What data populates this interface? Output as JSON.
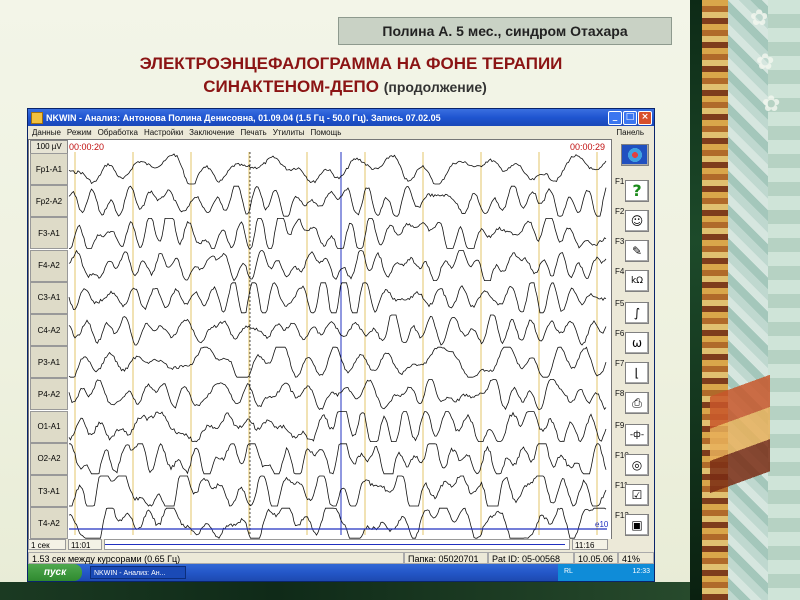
{
  "slide": {
    "patient_label": "Полина А. 5 мес., синдром Отахара",
    "title_line1": "ЭЛЕКТРОЭНЦЕФАЛОГРАММА НА ФОНЕ ТЕРАПИИ",
    "title_line2": "СИНАКТЕНОМ-ДЕПО",
    "title_line2_suffix": "(продолжение)"
  },
  "window": {
    "title": "NKWIN - Анализ: Антонова Полина Денисовна, 01.09.04 (1.5 Гц - 50.0 Гц). Запись 07.02.05",
    "buttons": [
      "_",
      "□",
      "×"
    ]
  },
  "menu": {
    "items": [
      "Данные",
      "Режим",
      "Обработка",
      "Настройки",
      "Заключение",
      "Печать",
      "Утилиты",
      "Помощь"
    ],
    "panel": "Панель"
  },
  "eeg": {
    "scale": "100 µV",
    "time_start": "00:00:20",
    "time_end": "00:00:29",
    "channels": [
      "Fp1-A1",
      "Fp2-A2",
      "F3-A1",
      "F4-A2",
      "C3-A1",
      "C4-A2",
      "P3-A1",
      "P4-A2",
      "O1-A1",
      "O2-A2",
      "T3-A1",
      "T4-A2"
    ],
    "marker_label": "e10"
  },
  "side_panel": {
    "buttons": [
      {
        "key": "",
        "icon": "brain-map-icon"
      },
      {
        "key": "F1",
        "icon": "help-icon",
        "glyph": "?"
      },
      {
        "key": "F2",
        "icon": "face-icon",
        "glyph": "☺"
      },
      {
        "key": "F3",
        "icon": "pen-icon",
        "glyph": "✎"
      },
      {
        "key": "F4",
        "icon": "impedance-icon",
        "glyph": "kΩ"
      },
      {
        "key": "F5",
        "icon": "curve-icon",
        "glyph": "∫"
      },
      {
        "key": "F6",
        "icon": "omega-icon",
        "glyph": "ω"
      },
      {
        "key": "F7",
        "icon": "graph-icon",
        "glyph": "⌊"
      },
      {
        "key": "F8",
        "icon": "printer-icon",
        "glyph": "⎙"
      },
      {
        "key": "F9",
        "icon": "dipole-icon",
        "glyph": "-ф-"
      },
      {
        "key": "F10",
        "icon": "globe-icon",
        "glyph": "◎"
      },
      {
        "key": "F11",
        "icon": "checklist-icon",
        "glyph": "☑"
      },
      {
        "key": "F12",
        "icon": "monitor-icon",
        "glyph": "▣"
      }
    ]
  },
  "status": {
    "row1_left": "1 сек",
    "row1_time": "11:01",
    "row1_right_time": "11:16",
    "cursor_info": "1.53 сек между курсорами (0.65 Гц)",
    "folder": "Папка: 05020701",
    "pat_id": "Pat ID: 05-00568",
    "date": "10.05.06",
    "percent": "41%"
  },
  "taskbar": {
    "start": "пуск",
    "task": "NKWIN - Анализ: Ан...",
    "lang": "RL",
    "clock": "12:33"
  },
  "colors": {
    "title_red": "#8b1414",
    "trace": "#111111",
    "second_line": "#e3c46a",
    "cursor_blue": "#2030c0"
  }
}
